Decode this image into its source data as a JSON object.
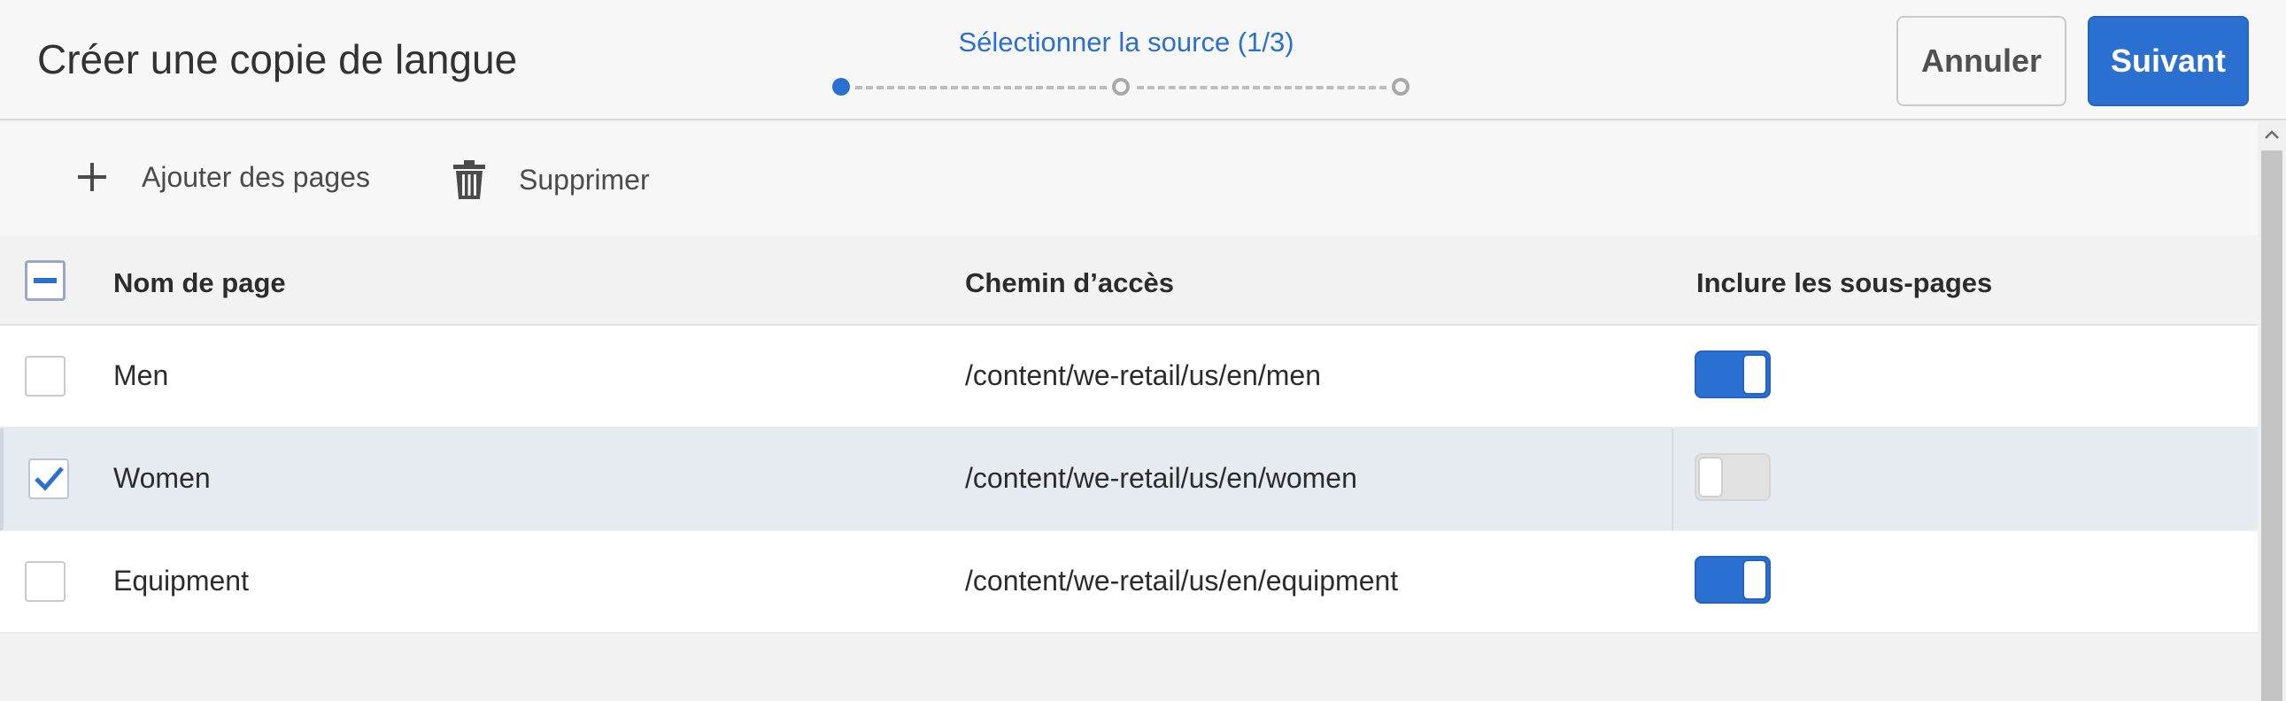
{
  "header": {
    "title": "Créer une copie de langue",
    "step_label": "Sélectionner la source (1/3)",
    "cancel_label": "Annuler",
    "next_label": "Suivant"
  },
  "stepper": {
    "current_step": 1,
    "total_steps": 3
  },
  "toolbar": {
    "add_label": "Ajouter des pages",
    "delete_label": "Supprimer"
  },
  "table": {
    "columns": [
      "Nom de page",
      "Chemin d’accès",
      "Inclure les sous-pages"
    ],
    "header_checkbox_state": "indeterminate",
    "rows": [
      {
        "name": "Men",
        "path": "/content/we-retail/us/en/men",
        "selected": false,
        "include_subpages": true
      },
      {
        "name": "Women",
        "path": "/content/we-retail/us/en/women",
        "selected": true,
        "include_subpages": false
      },
      {
        "name": "Equipment",
        "path": "/content/we-retail/us/en/equipment",
        "selected": false,
        "include_subpages": true
      }
    ]
  },
  "colors": {
    "accent": "#2b6fd0",
    "selected_row": "#e6eaf1"
  },
  "icons": {
    "add": "plus-icon",
    "delete": "trash-icon",
    "check": "checkmark-icon",
    "scroll_up": "chevron-up-icon"
  }
}
